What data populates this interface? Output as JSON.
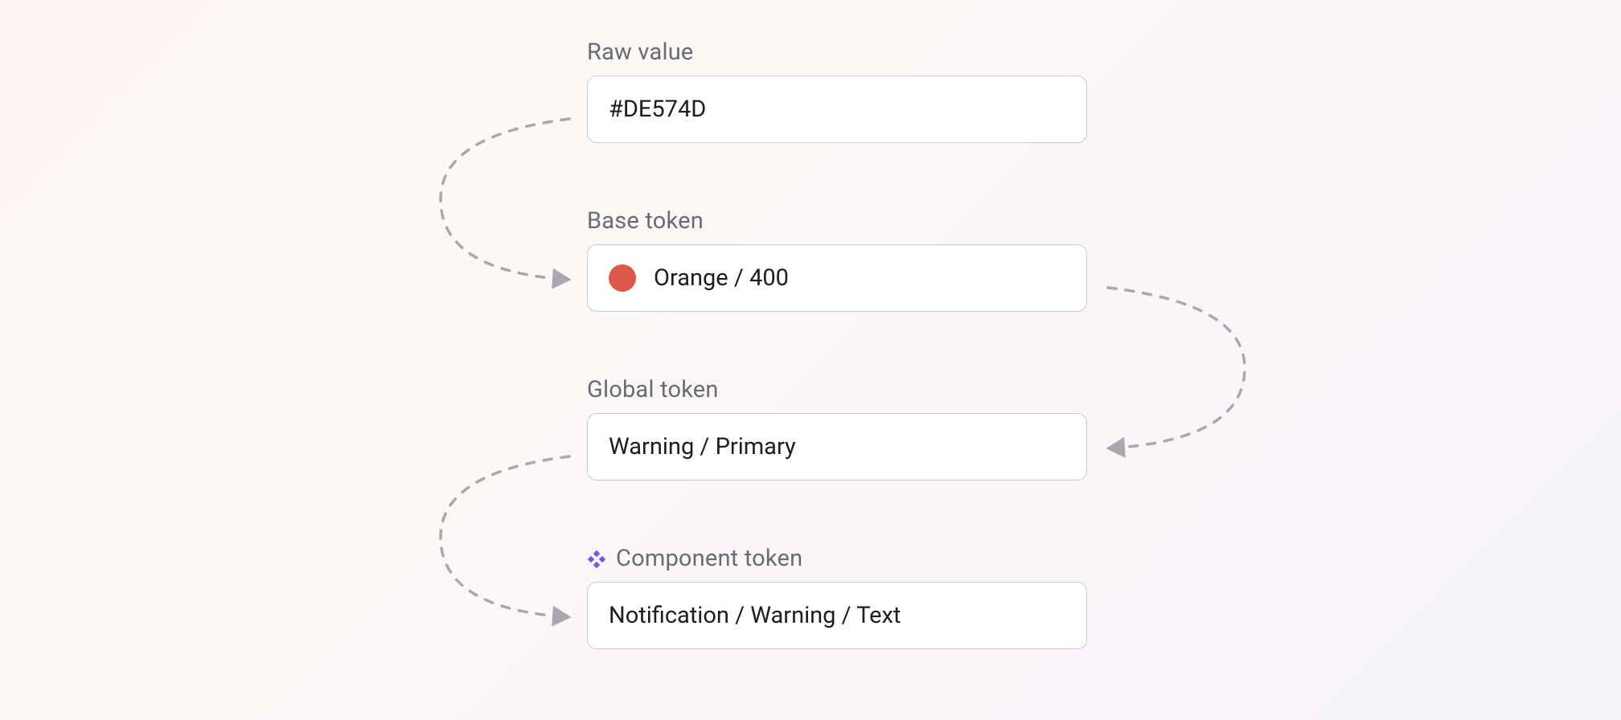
{
  "labels": {
    "raw": "Raw value",
    "base": "Base token",
    "global": "Global token",
    "component": "Component token"
  },
  "values": {
    "raw": "#DE574D",
    "base": "Orange / 400",
    "global": "Warning / Primary",
    "component": "Notification / Warning / Text"
  },
  "colors": {
    "swatch": "#DE574D",
    "icon": "#6C5CE7",
    "dash": "#A8A8B0"
  }
}
